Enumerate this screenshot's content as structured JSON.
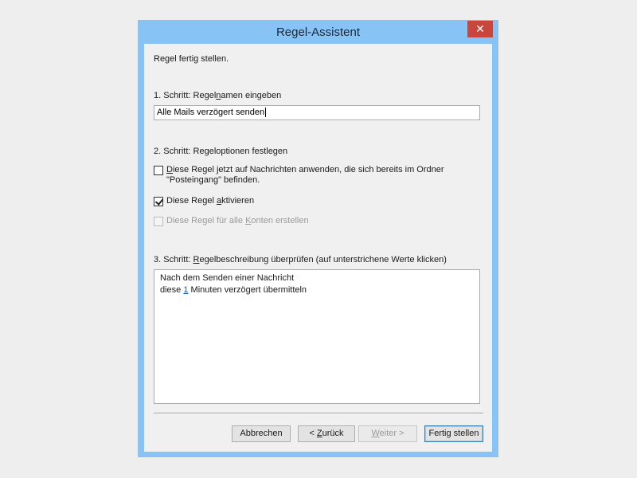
{
  "window": {
    "title": "Regel-Assistent",
    "close_glyph": "✕"
  },
  "intro": "Regel fertig stellen.",
  "step1": {
    "label_pre": "1. Schritt: Regel",
    "label_acc": "n",
    "label_post": "amen eingeben",
    "rule_name_value": "Alle Mails verzögert senden"
  },
  "step2": {
    "label": "2. Schritt: Regeloptionen festlegen",
    "options": [
      {
        "label_acc": "D",
        "label_post": "iese Regel jetzt auf Nachrichten anwenden, die sich bereits im Ordner",
        "label_line2": "\"Posteingang\" befinden.",
        "checked": false,
        "enabled": true
      },
      {
        "label_pre": "Diese Regel ",
        "label_acc": "a",
        "label_post": "ktivieren",
        "checked": true,
        "enabled": true
      },
      {
        "label_pre": "Diese Regel für alle ",
        "label_acc": "K",
        "label_post": "onten erstellen",
        "checked": false,
        "enabled": false
      }
    ]
  },
  "step3": {
    "label_pre": "3. Schritt: ",
    "label_acc": "R",
    "label_post": "egelbeschreibung überprüfen (auf unterstrichene Werte klicken)",
    "description_line1": "Nach dem Senden einer Nachricht",
    "description_line2_pre": "diese ",
    "description_link": "1",
    "description_line2_post": " Minuten verzögert übermitteln"
  },
  "buttons": {
    "cancel": "Abbrechen",
    "back_pre": "< ",
    "back_acc": "Z",
    "back_post": "urück",
    "next_acc": "W",
    "next_post": "eiter >",
    "finish": "Fertig stellen"
  },
  "colors": {
    "titlebar": "#87c3f5",
    "close_button": "#c9463d",
    "link": "#1a5fb4"
  }
}
